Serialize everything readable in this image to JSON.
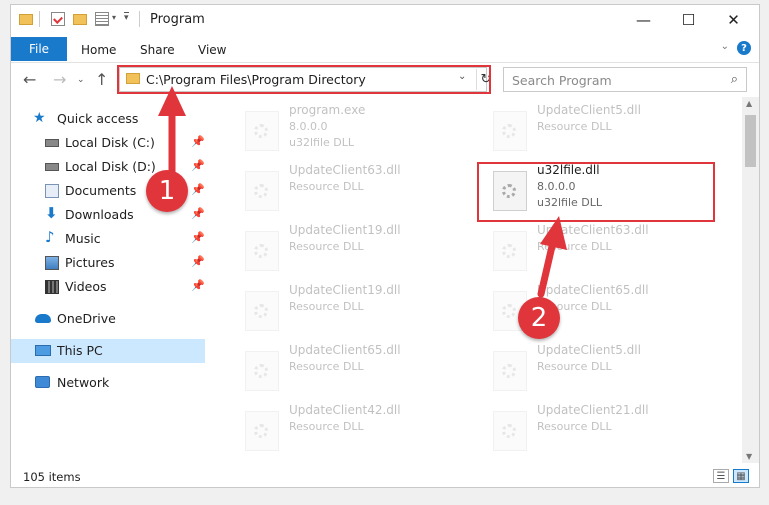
{
  "window": {
    "title": "Program",
    "controls": {
      "minimize": "—",
      "maximize": "☐",
      "close": "✕"
    }
  },
  "ribbon": {
    "tabs": [
      "File",
      "Home",
      "Share",
      "View"
    ],
    "help": "?"
  },
  "address": {
    "path": "C:\\Program Files\\Program Directory",
    "search_placeholder": "Search Program"
  },
  "sidebar": {
    "items": [
      {
        "label": "Quick access",
        "icon": "star-icon",
        "pinned": false
      },
      {
        "label": "Local Disk (C:)",
        "icon": "drive-icon",
        "pinned": true
      },
      {
        "label": "Local Disk (D:)",
        "icon": "drive-icon",
        "pinned": true
      },
      {
        "label": "Documents",
        "icon": "documents-icon",
        "pinned": true
      },
      {
        "label": "Downloads",
        "icon": "download-icon",
        "pinned": true
      },
      {
        "label": "Music",
        "icon": "music-icon",
        "pinned": true
      },
      {
        "label": "Pictures",
        "icon": "pictures-icon",
        "pinned": true
      },
      {
        "label": "Videos",
        "icon": "videos-icon",
        "pinned": true
      },
      {
        "label": "OneDrive",
        "icon": "cloud-icon",
        "pinned": false
      },
      {
        "label": "This PC",
        "icon": "computer-icon",
        "pinned": false,
        "selected": true
      },
      {
        "label": "Network",
        "icon": "network-icon",
        "pinned": false
      }
    ]
  },
  "files": [
    {
      "name": "program.exe",
      "line2": "8.0.0.0",
      "line3": "u32lfile DLL",
      "faded": true
    },
    {
      "name": "UpdateClient5.dll",
      "line2": "Resource DLL",
      "line3": "",
      "faded": true
    },
    {
      "name": "UpdateClient63.dll",
      "line2": "Resource DLL",
      "line3": "",
      "faded": true
    },
    {
      "name": "u32lfile.dll",
      "line2": "8.0.0.0",
      "line3": "u32lfile DLL",
      "faded": false
    },
    {
      "name": "UpdateClient19.dll",
      "line2": "Resource DLL",
      "line3": "",
      "faded": true
    },
    {
      "name": "UpdateClient63.dll",
      "line2": "Resource DLL",
      "line3": "",
      "faded": true
    },
    {
      "name": "UpdateClient19.dll",
      "line2": "Resource DLL",
      "line3": "",
      "faded": true
    },
    {
      "name": "UpdateClient65.dll",
      "line2": "Resource DLL",
      "line3": "",
      "faded": true
    },
    {
      "name": "UpdateClient65.dll",
      "line2": "Resource DLL",
      "line3": "",
      "faded": true
    },
    {
      "name": "UpdateClient5.dll",
      "line2": "Resource DLL",
      "line3": "",
      "faded": true
    },
    {
      "name": "UpdateClient42.dll",
      "line2": "Resource DLL",
      "line3": "",
      "faded": true
    },
    {
      "name": "UpdateClient21.dll",
      "line2": "Resource DLL",
      "line3": "",
      "faded": true
    }
  ],
  "status": {
    "count": "105 items"
  },
  "annotations": {
    "step1": "1",
    "step2": "2"
  },
  "colors": {
    "accent": "#1979ca",
    "highlight": "#e0353b",
    "selected": "#cce8ff"
  }
}
